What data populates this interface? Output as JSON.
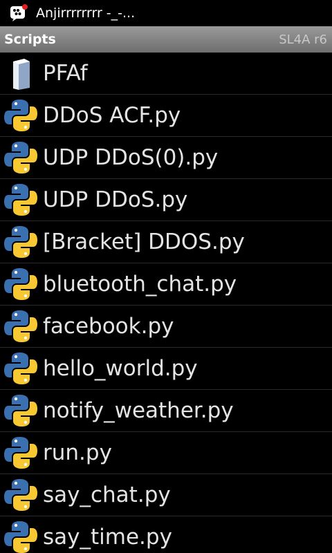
{
  "statusbar": {
    "notification_icon": "bbm-icon",
    "notification_text": "Anjirrrrrrrr -_-..."
  },
  "titlebar": {
    "title": "Scripts",
    "version": "SL4A r6"
  },
  "scripts": [
    {
      "label": "PFAf",
      "icon": "folder-icon"
    },
    {
      "label": "DDoS ACF.py",
      "icon": "python-icon"
    },
    {
      "label": "UDP DDoS(0).py",
      "icon": "python-icon"
    },
    {
      "label": "UDP DDoS.py",
      "icon": "python-icon"
    },
    {
      "label": "[Bracket] DDOS.py",
      "icon": "python-icon"
    },
    {
      "label": "bluetooth_chat.py",
      "icon": "python-icon"
    },
    {
      "label": "facebook.py",
      "icon": "python-icon"
    },
    {
      "label": "hello_world.py",
      "icon": "python-icon"
    },
    {
      "label": "notify_weather.py",
      "icon": "python-icon"
    },
    {
      "label": "run.py",
      "icon": "python-icon"
    },
    {
      "label": "say_chat.py",
      "icon": "python-icon"
    },
    {
      "label": "say_time.py",
      "icon": "python-icon"
    }
  ],
  "colors": {
    "python_blue": "#3a6fb0",
    "python_yellow": "#f7c832",
    "folder": "#e8eef6"
  }
}
